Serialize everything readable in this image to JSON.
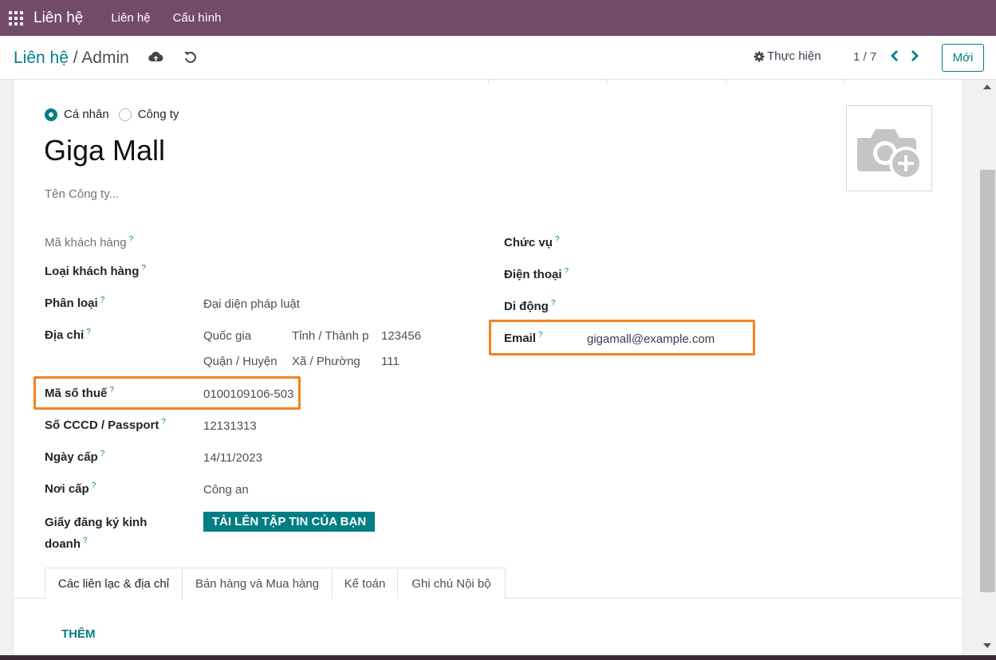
{
  "navbar": {
    "app_name": "Liên hệ",
    "menu": [
      "Liên hệ",
      "Cấu hình"
    ]
  },
  "control": {
    "breadcrumb_parent": "Liên hệ",
    "breadcrumb_sep": "/",
    "breadcrumb_current": "Admin",
    "action_label": "Thực hiện",
    "pager": "1 / 7",
    "new_label": "Mới"
  },
  "form": {
    "type_options": [
      "Cá nhân",
      "Công ty"
    ],
    "type_selected": "Cá nhân",
    "name": "Giga Mall",
    "company_placeholder": "Tên Công ty...",
    "left_fields": {
      "customer_code": {
        "label": "Mã khách hàng",
        "value": ""
      },
      "customer_type": {
        "label": "Loại khách hàng",
        "value": ""
      },
      "classification": {
        "label": "Phân loại",
        "value": "Đại diện pháp luật"
      },
      "address": {
        "label": "Địa chỉ",
        "country": "Quốc gia",
        "province": "Tỉnh / Thành p",
        "zip": "123456",
        "district": "Quận / Huyện",
        "ward": "Xã / Phường",
        "street": "111"
      },
      "tax_id": {
        "label": "Mã số thuế",
        "value": "0100109106-503"
      },
      "id_number": {
        "label": "Số CCCD / Passport",
        "value": "12131313"
      },
      "issue_date": {
        "label": "Ngày cấp",
        "value": "14/11/2023"
      },
      "issue_place": {
        "label": "Nơi cấp",
        "value": "Công an"
      },
      "business_license": {
        "label_line1": "Giấy đăng ký kinh",
        "label_line2": "doanh",
        "button": "TẢI LÊN TẬP TIN CỦA BẠN"
      }
    },
    "right_fields": {
      "job_title": {
        "label": "Chức vụ",
        "value": ""
      },
      "phone": {
        "label": "Điện thoại",
        "value": ""
      },
      "mobile": {
        "label": "Di động",
        "value": ""
      },
      "email": {
        "label": "Email",
        "value": "gigamall@example.com"
      }
    },
    "help_mark": "?",
    "tabs": [
      "Các liên lạc & địa chỉ",
      "Bán hàng và Mua hàng",
      "Kế toán",
      "Ghi chú Nội bộ"
    ],
    "active_tab": "Các liên lạc & địa chỉ",
    "add_label": "THÊM"
  },
  "colors": {
    "navbar": "#714b67",
    "accent": "#017e84",
    "highlight": "#f5821f"
  }
}
